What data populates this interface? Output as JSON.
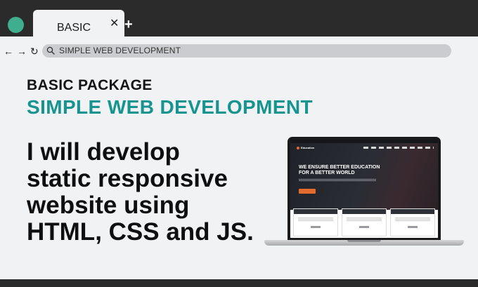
{
  "browser": {
    "tab_label": "BASIC",
    "tab_close_glyph": "✕",
    "new_tab_glyph": "+",
    "back_glyph": "←",
    "forward_glyph": "→",
    "reload_glyph": "↻",
    "address_text": "SIMPLE WEB DEVELOPMENT"
  },
  "content": {
    "package_label": "BASIC PACKAGE",
    "subtitle": "SIMPLE WEB DEVELOPMENT",
    "headline_lines": [
      "I will develop",
      "static responsive",
      "website using",
      "HTML, CSS and JS."
    ]
  },
  "laptop_site": {
    "logo_text": "Education",
    "hero_title_line1": "WE ENSURE BETTER EDUCATION",
    "hero_title_line2": "FOR A BETTER WORLD"
  },
  "icons": {
    "status_dot": "status-dot",
    "search": "search-icon"
  },
  "colors": {
    "accent_teal": "#17948f",
    "status_dot_green": "#3fae8e",
    "chrome_dark": "#2b2b2b",
    "page_bg": "#f1f2f4",
    "site_orange": "#e46b2d"
  }
}
